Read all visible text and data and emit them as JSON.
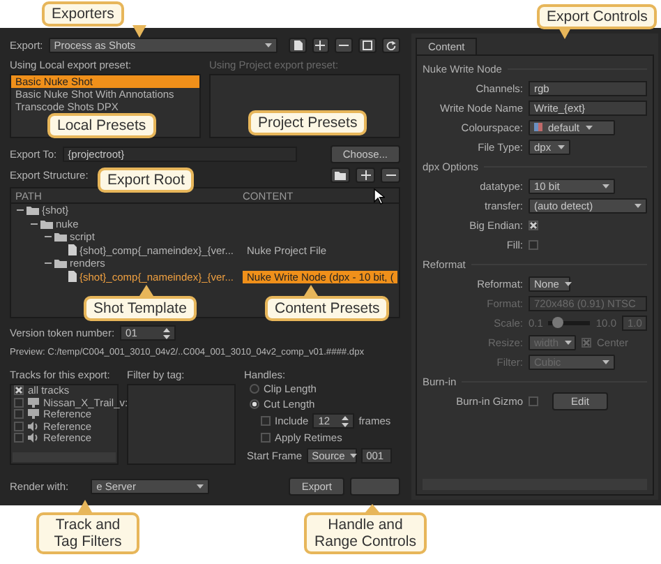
{
  "callouts": [
    "Exporters",
    "Local Presets",
    "Project Presets",
    "Export Root",
    "Shot Template",
    "Content Presets",
    "Track and Tag Filters",
    "Handle and Range Controls",
    "Export Controls"
  ],
  "export": {
    "label": "Export:",
    "value": "Process as Shots"
  },
  "local_presets": {
    "label": "Using Local export preset:",
    "items": [
      {
        "text": "Basic Nuke Shot",
        "selected": true
      },
      {
        "text": "Basic Nuke Shot With Annotations",
        "selected": false
      },
      {
        "text": "Transcode Shots DPX",
        "selected": false
      }
    ]
  },
  "project_presets": {
    "label": "Using Project export preset:",
    "disabled": true
  },
  "export_to": {
    "label": "Export To:",
    "value": "{projectroot}",
    "button": "Choose..."
  },
  "export_structure": {
    "label": "Export Structure:"
  },
  "structure": {
    "columns": [
      "PATH",
      "CONTENT"
    ],
    "nodes": [
      {
        "kind": "folder",
        "name": "{shot}",
        "selected": false,
        "children": [
          {
            "kind": "folder",
            "name": "nuke",
            "selected": false,
            "children": [
              {
                "kind": "folder",
                "name": "script",
                "selected": false,
                "children": [
                  {
                    "kind": "file",
                    "name": "{shot}_comp{_nameindex}_{ver...",
                    "content": "Nuke Project File",
                    "selected": false
                  }
                ]
              },
              {
                "kind": "folder",
                "name": "renders",
                "selected": false,
                "children": [
                  {
                    "kind": "file",
                    "name": "{shot}_comp{_nameindex}_{ver...",
                    "content": "Nuke Write Node (dpx - 10 bit, (",
                    "selected": true
                  }
                ]
              }
            ]
          }
        ]
      }
    ]
  },
  "version_token": {
    "label": "Version token number:",
    "value": "01"
  },
  "preview": "Preview: C:/temp/C004_001_3010_04v2/..C004_001_3010_04v2_comp_v01.####.dpx",
  "tracks": {
    "label": "Tracks for this export:",
    "items": [
      {
        "kind": "all",
        "text": "all tracks",
        "checked": true
      },
      {
        "kind": "video",
        "text": "Nissan_X_Trail_v:",
        "checked": false
      },
      {
        "kind": "video",
        "text": "Reference",
        "checked": false
      },
      {
        "kind": "audio",
        "text": "Reference",
        "checked": false
      },
      {
        "kind": "audio",
        "text": "Reference",
        "checked": false
      }
    ]
  },
  "filter_by_tag": {
    "label": "Filter by tag:"
  },
  "handles": {
    "label": "Handles:",
    "options": [
      {
        "text": "Clip Length",
        "selected": false
      },
      {
        "text": "Cut Length",
        "selected": true
      }
    ],
    "include": {
      "label": "Include",
      "checked": false,
      "value": "12",
      "unit": "frames"
    },
    "apply_retimes": {
      "label": "Apply Retimes",
      "checked": false
    },
    "start_frame": {
      "label": "Start Frame",
      "value": "Source",
      "number": "001"
    }
  },
  "render_with": {
    "label": "Render with:",
    "value": "e Server"
  },
  "buttons": [
    "Export"
  ],
  "content_panel": {
    "tab": "Content",
    "sections": [
      {
        "title": "Nuke Write Node",
        "rows": [
          {
            "kind": "field",
            "label": "Channels:",
            "value": "rgb",
            "disabled": false
          },
          {
            "kind": "field",
            "label": "Write Node Name",
            "value": "Write_{ext}",
            "disabled": false
          },
          {
            "kind": "colour_dropdown",
            "label": "Colourspace:",
            "value": "default",
            "disabled": false
          },
          {
            "kind": "dropdown",
            "label": "File Type:",
            "value": "dpx",
            "disabled": false
          }
        ]
      },
      {
        "title": "dpx Options",
        "rows": [
          {
            "kind": "dropdown",
            "label": "datatype:",
            "value": "10 bit",
            "disabled": false
          },
          {
            "kind": "dropdown",
            "label": "transfer:",
            "value": "(auto detect)",
            "disabled": false
          },
          {
            "kind": "checkbox",
            "label": "Big Endian:",
            "checked": true,
            "disabled": false
          },
          {
            "kind": "checkbox",
            "label": "Fill:",
            "checked": false,
            "disabled": false
          }
        ]
      },
      {
        "title": "Reformat",
        "rows": [
          {
            "kind": "dropdown",
            "label": "Reformat:",
            "value": "None",
            "disabled": false
          },
          {
            "kind": "field",
            "label": "Format:",
            "value": "720x486 (0.91) NTSC",
            "disabled": true
          },
          {
            "kind": "slider",
            "label": "Scale:",
            "min": "0.1",
            "max": "10.0",
            "value": "1.0",
            "level": 0.1,
            "disabled": true
          },
          {
            "kind": "dropdown_check",
            "label": "Resize:",
            "value": "width",
            "check_label": "Center",
            "checked": true,
            "disabled": true
          },
          {
            "kind": "dropdown",
            "label": "Filter:",
            "value": "Cubic",
            "disabled": true
          }
        ]
      },
      {
        "title": "Burn-in",
        "rows": [
          {
            "kind": "checkbox_button",
            "label": "Burn-in Gizmo",
            "checked": false,
            "button": "Edit",
            "disabled": false
          }
        ]
      }
    ]
  }
}
